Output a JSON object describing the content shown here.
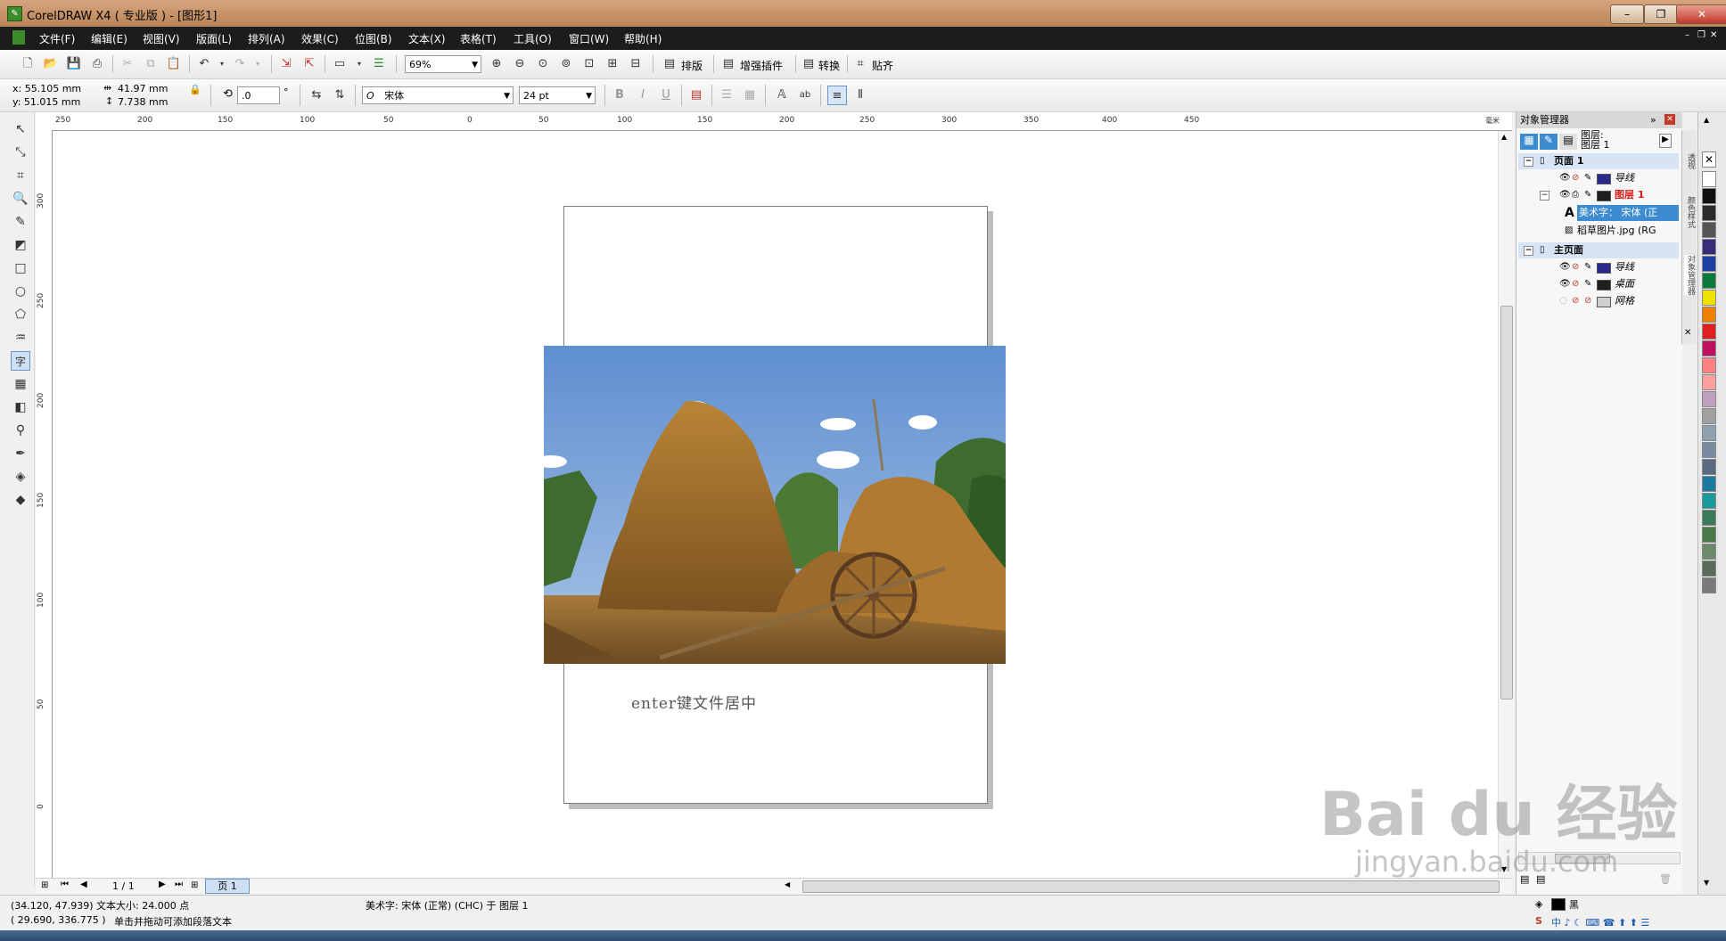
{
  "window": {
    "title": "CorelDRAW X4 ( 专业版 ) - [图形1]",
    "controls": [
      "–",
      "❐",
      "✕"
    ]
  },
  "menu": [
    "文件(F)",
    "编辑(E)",
    "视图(V)",
    "版面(L)",
    "排列(A)",
    "效果(C)",
    "位图(B)",
    "文本(X)",
    "表格(T)",
    "工具(O)",
    "窗口(W)",
    "帮助(H)"
  ],
  "toolbar1": {
    "zoom": "69%",
    "buttons": [
      "排版",
      "增强插件",
      "转换",
      "贴齐"
    ]
  },
  "propbar": {
    "x": "x: 55.105 mm",
    "y": "y: 51.015 mm",
    "w": "41.97 mm",
    "h": "7.738 mm",
    "rotation": ".0",
    "degree": "°",
    "font": "宋体",
    "size": "24 pt"
  },
  "ruler": {
    "h_labels": [
      "250",
      "200",
      "150",
      "100",
      "50",
      "0",
      "50",
      "100",
      "150",
      "200",
      "250",
      "300",
      "350",
      "400",
      "450"
    ],
    "h_unit": "毫米",
    "v_labels": [
      "300",
      "250",
      "200",
      "150",
      "100",
      "50",
      "0"
    ]
  },
  "canvas": {
    "caption": "enter键文件居中"
  },
  "pager": {
    "current": "1 / 1",
    "page_tab": "页 1"
  },
  "object_manager": {
    "title": "对象管理器",
    "layer_info": [
      "图层:",
      "图层 1"
    ],
    "tree": [
      {
        "label": "页面 1",
        "kind": "header"
      },
      {
        "label": "导线",
        "kind": "layer",
        "color": "#2a2a8c"
      },
      {
        "label": "图层 1",
        "kind": "layer-active",
        "color": "#1f1f1f"
      },
      {
        "label": "美术字： 宋体 (正",
        "kind": "object-selected"
      },
      {
        "label": "稻草图片.jpg (RG",
        "kind": "object"
      },
      {
        "label": "主页面",
        "kind": "header"
      },
      {
        "label": "导线",
        "kind": "layer",
        "color": "#2a2a8c"
      },
      {
        "label": "桌面",
        "kind": "layer",
        "color": "#1f1f1f"
      },
      {
        "label": "网格",
        "kind": "layer",
        "color": "#cfcfcf"
      }
    ]
  },
  "side_tabs": [
    "透视",
    "颜色样式",
    "对象管理器"
  ],
  "palette": [
    "#ffffff",
    "#111111",
    "#2b2b2b",
    "#555555",
    "#3a2a7a",
    "#1a3fa0",
    "#0a7a3a",
    "#f0e000",
    "#f08000",
    "#e02020",
    "#c01060",
    "#ff8080",
    "#ffa0a0",
    "#c0a0c0",
    "#a0a0a0",
    "#8fa0b0",
    "#7a8aa0",
    "#5a6a80",
    "#1a7aa0",
    "#1a9a9a",
    "#3a7a5a",
    "#4a7a4a",
    "#6a8a6a",
    "#5a6a5a",
    "#7a7a7a"
  ],
  "status": {
    "line1_left": "(34.120, 47.939) 文本大小: 24.000 点",
    "line1_mid": "美术字: 宋体 (正常) (CHC) 于 图层 1",
    "line2_left": "( 29.690, 336.775 )",
    "line2_mid": "单击并拖动可添加段落文本",
    "fill_label": "黑"
  },
  "watermark": {
    "line1": "Bai du 经验",
    "line2": "jingyan.baidu.com"
  }
}
